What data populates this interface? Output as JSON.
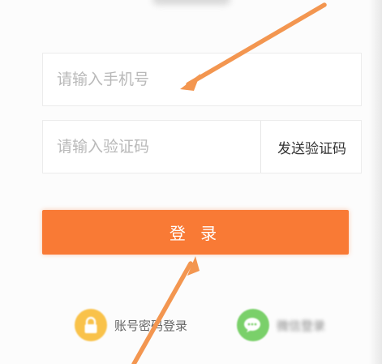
{
  "phone_input": {
    "placeholder": "请输入手机号",
    "value": ""
  },
  "code_input": {
    "placeholder": "请输入验证码",
    "value": ""
  },
  "send_code_label": "发送验证码",
  "login_label": "登 录",
  "alt_logins": {
    "password_label": "账号密码登录",
    "wechat_label": "微信登录"
  },
  "colors": {
    "accent": "#f97a35",
    "lock_icon_bg": "#f9c24a",
    "wechat_icon_bg": "#7ad06a",
    "annotation_arrow": "#f39650"
  },
  "icons": [
    "lock-icon",
    "wechat-icon"
  ]
}
